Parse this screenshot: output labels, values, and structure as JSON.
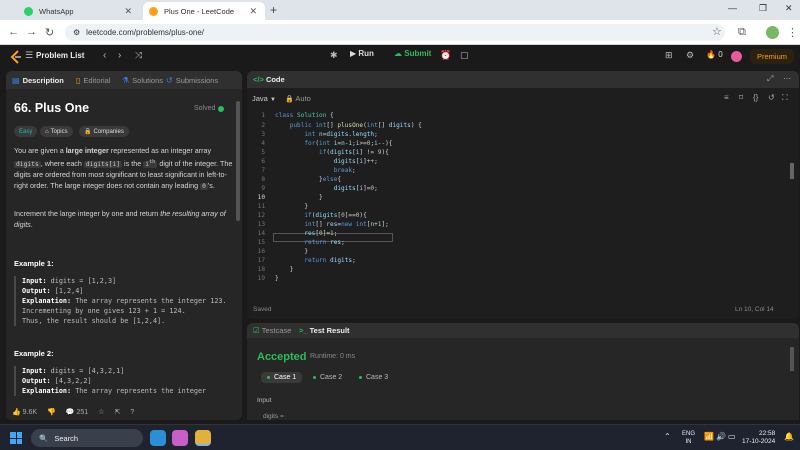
{
  "browser": {
    "tabs": [
      {
        "title": "WhatsApp",
        "color": "#25d366"
      },
      {
        "title": "Plus One - LeetCode",
        "color": "#ffa116"
      }
    ],
    "new_tab_symbol": "+",
    "url": "leetcode.com/problems/plus-one/"
  },
  "navbar": {
    "problem_list": "Problem List",
    "run": "Run",
    "submit": "Submit",
    "streak": "0",
    "premium": "Premium"
  },
  "description": {
    "tabs": [
      "Description",
      "Editorial",
      "Solutions",
      "Submissions"
    ],
    "title": "66. Plus One",
    "status": "Solved",
    "chips": [
      "Easy",
      "Topics",
      "Companies"
    ],
    "p1": {
      "a": "You are given a ",
      "b": "large integer",
      "c": " represented as an integer array ",
      "d": "digits",
      "e": ", where each ",
      "f": "digits[i]",
      "g": " is the ",
      "h": "i",
      "i": "th",
      "j": " digit of the integer. The digits are ordered from most significant to least significant in left-to-right order. The large integer does not contain any leading ",
      "k": "0",
      "l": "'s."
    },
    "p2": {
      "a": "Increment the large integer by one and return ",
      "b": "the resulting array of digits",
      "c": "."
    },
    "example1": {
      "heading": "Example 1:",
      "input_label": "Input:",
      "input": "digits = [1,2,3]",
      "output_label": "Output:",
      "output": "[1,2,4]",
      "expl_label": "Explanation:",
      "expl": "The array represents the integer 123.",
      "line2": "Incrementing by one gives 123 + 1 = 124.",
      "line3": "Thus, the result should be [1,2,4]."
    },
    "example2": {
      "heading": "Example 2:",
      "input_label": "Input:",
      "input": "digits = [4,3,2,1]",
      "output_label": "Output:",
      "output": "[4,3,2,2]",
      "expl_label": "Explanation:",
      "expl": "The array represents the integer"
    },
    "footer": {
      "likes": "9.6K",
      "comments": "251"
    }
  },
  "code": {
    "header": "Code",
    "language": "Java",
    "mode": "Auto",
    "saved": "Saved",
    "cursor": "Ln 10, Col 14",
    "current_line": 10
  },
  "result": {
    "tabs": [
      "Testcase",
      "Test Result"
    ],
    "verdict": "Accepted",
    "runtime": "Runtime: 0 ms",
    "cases": [
      "Case 1",
      "Case 2",
      "Case 3"
    ],
    "input_label": "Input",
    "first_param": "digits ="
  },
  "taskbar": {
    "search": "Search",
    "lang1": "ENG",
    "lang2": "IN",
    "time": "22:58",
    "date": "17-10-2024"
  }
}
